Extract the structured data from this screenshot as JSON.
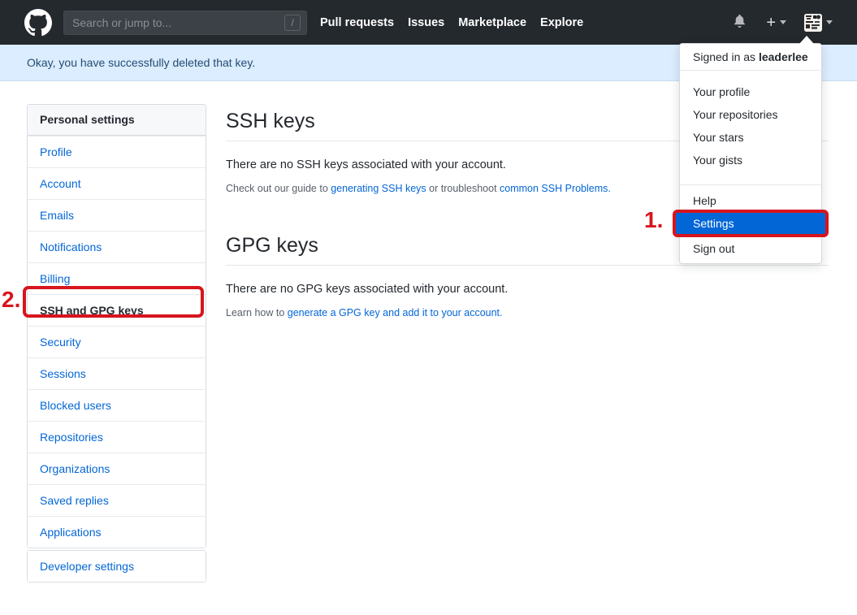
{
  "header": {
    "search_placeholder": "Search or jump to...",
    "search_shortcut": "/",
    "nav": [
      "Pull requests",
      "Issues",
      "Marketplace",
      "Explore"
    ]
  },
  "flash": "Okay, you have successfully deleted that key.",
  "user_menu": {
    "signed_in_prefix": "Signed in as ",
    "username": "leaderlee",
    "profile_items": [
      "Your profile",
      "Your repositories",
      "Your stars",
      "Your gists"
    ],
    "help_label": "Help",
    "settings_label": "Settings",
    "signout_label": "Sign out"
  },
  "sidebar": {
    "header": "Personal settings",
    "items": [
      "Profile",
      "Account",
      "Emails",
      "Notifications",
      "Billing",
      "SSH and GPG keys",
      "Security",
      "Sessions",
      "Blocked users",
      "Repositories",
      "Organizations",
      "Saved replies",
      "Applications"
    ],
    "selected_item": "SSH and GPG keys",
    "developer_settings": "Developer settings"
  },
  "main": {
    "ssh": {
      "title": "SSH keys",
      "empty_message": "There are no SSH keys associated with your account.",
      "help_prefix": "Check out our guide to ",
      "help_link1": "generating SSH keys",
      "help_middle": " or troubleshoot ",
      "help_link2": "common SSH Problems."
    },
    "gpg": {
      "title": "GPG keys",
      "empty_message": "There are no GPG keys associated with your account.",
      "help_prefix": "Learn how to ",
      "help_link": "generate a GPG key and add it to your account."
    }
  },
  "annotations": {
    "step1": "1.",
    "step2": "2."
  },
  "icons": {
    "logo": "github-octocat-mark",
    "bell": "notifications-bell",
    "plus": "create-new-plus",
    "caret": "dropdown-caret",
    "search_shortcut_key": "slash-key"
  },
  "colors": {
    "header_bg": "#24292e",
    "flash_bg": "#dbedff",
    "link_blue": "#0366d6",
    "menu_highlight_blue": "#0366d6",
    "annotation_red": "#d7151d",
    "button_green": "#28a745"
  }
}
